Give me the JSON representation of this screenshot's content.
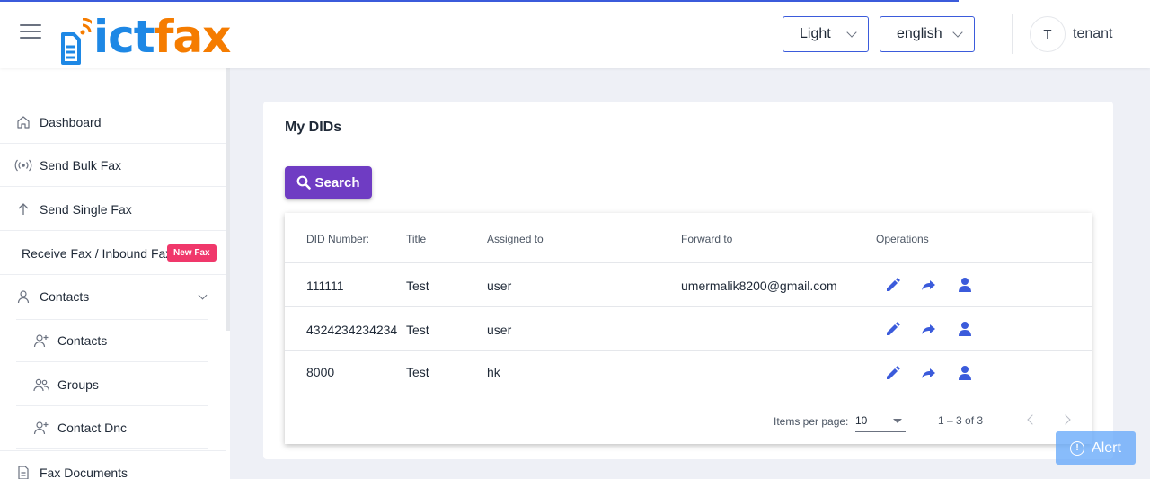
{
  "header": {
    "logo": {
      "part1": "ict",
      "part2": "fax"
    },
    "theme_select": {
      "value": "Light"
    },
    "language_select": {
      "value": "english"
    },
    "avatar_initial": "T",
    "username": "tenant"
  },
  "sidebar": {
    "items": [
      {
        "label": "Dashboard",
        "icon": "home-icon"
      },
      {
        "label": "Send Bulk Fax",
        "icon": "broadcast-icon"
      },
      {
        "label": "Send Single Fax",
        "icon": "arrow-up-icon"
      },
      {
        "label": "Receive Fax / Inbound Fax",
        "badge": "New Fax"
      },
      {
        "label": "Contacts",
        "icon": "user-icon"
      },
      {
        "label": "Contacts",
        "icon": "user-plus-icon"
      },
      {
        "label": "Groups",
        "icon": "users-icon"
      },
      {
        "label": "Contact Dnc",
        "icon": "user-plus-icon"
      },
      {
        "label": "Fax Documents",
        "icon": "document-icon"
      }
    ]
  },
  "main": {
    "title": "My DIDs",
    "search_label": "Search",
    "table": {
      "columns": [
        "DID Number:",
        "Title",
        "Assigned to",
        "Forward to",
        "Operations"
      ],
      "rows": [
        [
          "111111",
          "Test",
          "user",
          "umermalik8200@gmail.com"
        ],
        [
          "4324234234234",
          "Test",
          "user",
          ""
        ],
        [
          "8000",
          "Test",
          "hk",
          ""
        ]
      ]
    },
    "paginator": {
      "items_per_page_label": "Items per page:",
      "page_size": "10",
      "range": "1 – 3 of 3"
    }
  },
  "alert_label": "Alert",
  "colors": {
    "accent": "#3b5bdb",
    "search_button": "#6f3cc3",
    "badge": "#f0386b",
    "operation_icons": "#3b5bdb",
    "logo_blue": "#1e88e5",
    "logo_orange": "#f57c00"
  }
}
